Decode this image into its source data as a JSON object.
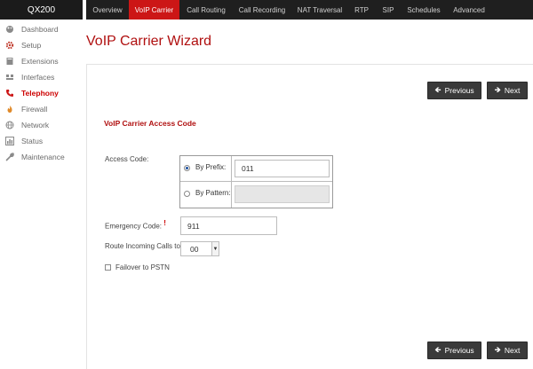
{
  "brand": "QX200",
  "sidebar": {
    "items": [
      {
        "label": "Dashboard",
        "icon": "palette-icon"
      },
      {
        "label": "Setup",
        "icon": "gear-icon"
      },
      {
        "label": "Extensions",
        "icon": "book-icon"
      },
      {
        "label": "Interfaces",
        "icon": "network-ports-icon"
      },
      {
        "label": "Telephony",
        "icon": "phone-icon",
        "active": true
      },
      {
        "label": "Firewall",
        "icon": "flame-icon"
      },
      {
        "label": "Network",
        "icon": "globe-icon"
      },
      {
        "label": "Status",
        "icon": "bar-chart-icon"
      },
      {
        "label": "Maintenance",
        "icon": "wrench-icon"
      }
    ]
  },
  "topnav": {
    "tabs": [
      {
        "label": "Overview"
      },
      {
        "label": "VoIP Carrier",
        "active": true
      },
      {
        "label": "Call Routing"
      },
      {
        "label": "Call Recording"
      },
      {
        "label": "NAT Traversal"
      },
      {
        "label": "RTP"
      },
      {
        "label": "SIP"
      },
      {
        "label": "Schedules"
      },
      {
        "label": "Advanced"
      }
    ]
  },
  "page": {
    "title": "VoIP Carrier Wizard"
  },
  "buttons": {
    "previous": "Previous",
    "next": "Next"
  },
  "form": {
    "section_title": "VoIP Carrier Access Code",
    "access_code_label": "Access Code:",
    "by_prefix_label": "By Prefix:",
    "by_prefix_value": "011",
    "by_pattern_label": "By Pattern:",
    "by_pattern_value": "",
    "emergency_code_label": "Emergency Code:",
    "required_mark": "!",
    "emergency_code_value": "911",
    "route_incoming_label": "Route Incoming Calls to:",
    "route_incoming_value": "00",
    "failover_label": "Failover to PSTN",
    "failover_checked": false
  },
  "colors": {
    "accent": "#cc1616",
    "nav_bg": "#1f1f1f",
    "button_bg": "#3a3a3a"
  }
}
